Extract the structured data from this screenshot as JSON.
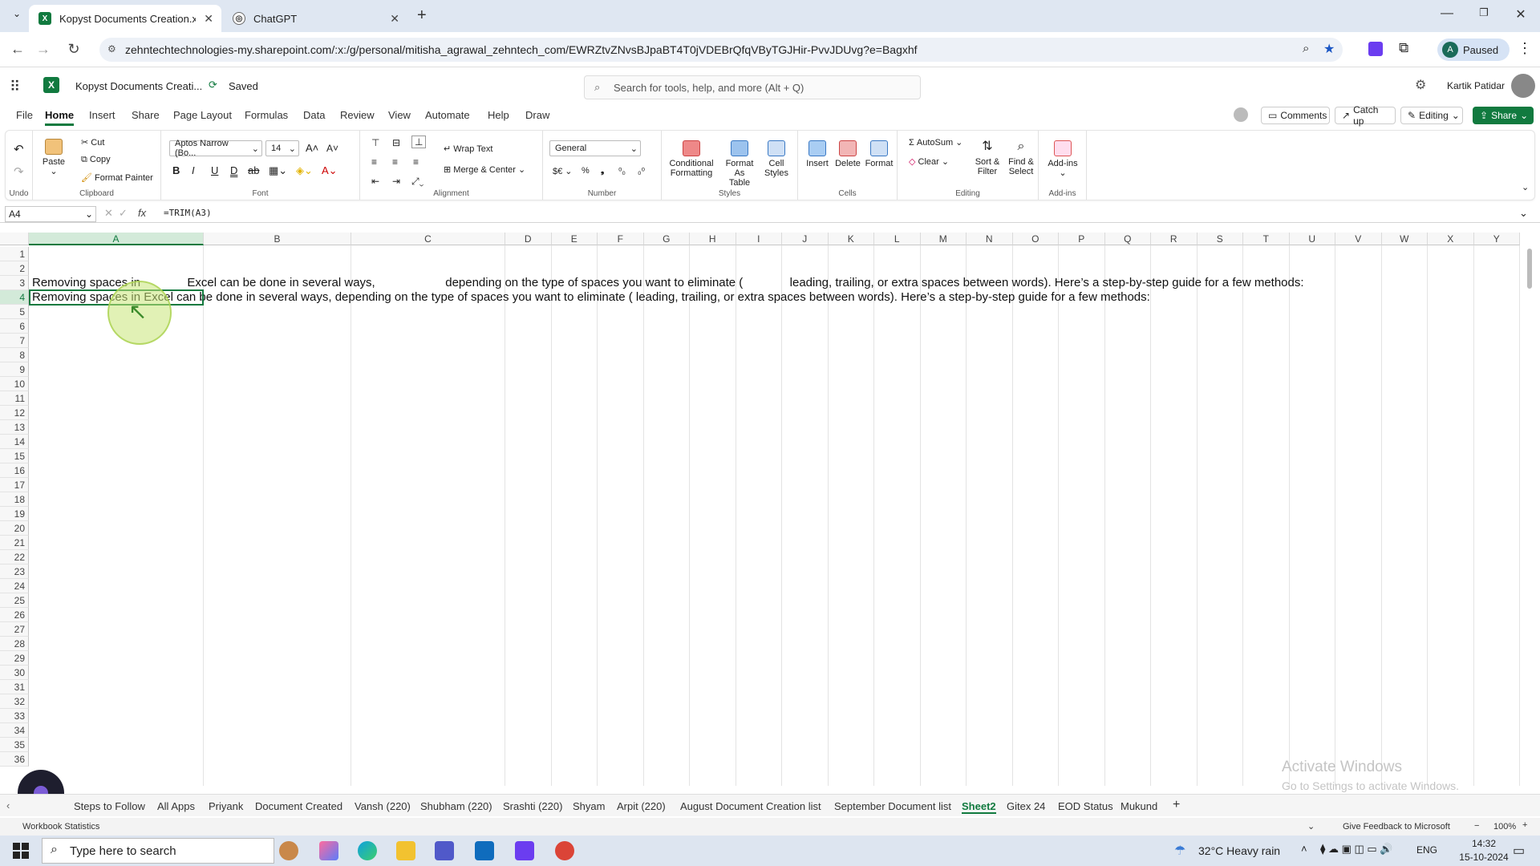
{
  "browser": {
    "tabs": [
      {
        "title": "Kopyst Documents Creation.xlsx"
      },
      {
        "title": "ChatGPT"
      }
    ],
    "new_tab": "+",
    "url": "zehntechtechnologies-my.sharepoint.com/:x:/g/personal/mitisha_agrawal_zehntech_com/EWRZtvZNvsBJpaBT4T0jVDEBrQfqVByTGJHir-PvvJDUvg?e=Bagxhf",
    "profile_letter": "A",
    "profile_status": "Paused"
  },
  "excel": {
    "doc_title": "Kopyst Documents Creati...",
    "save_status": "Saved",
    "search_placeholder": "Search for tools, help, and more (Alt + Q)",
    "user_name": "Kartik Patidar",
    "menu": [
      "File",
      "Home",
      "Insert",
      "Share",
      "Page Layout",
      "Formulas",
      "Data",
      "Review",
      "View",
      "Automate",
      "Help",
      "Draw"
    ],
    "active_menu": "Home",
    "comments": "Comments",
    "catch_up": "Catch up",
    "editing": "Editing",
    "share": "Share"
  },
  "ribbon": {
    "undo_label": "Undo",
    "paste": "Paste",
    "cut": "Cut",
    "copy": "Copy",
    "format_painter": "Format Painter",
    "clipboard_label": "Clipboard",
    "font_name": "Aptos Narrow (Bo...",
    "font_size": "14",
    "font_label": "Font",
    "wrap_text": "Wrap Text",
    "merge_center": "Merge & Center",
    "alignment_label": "Alignment",
    "number_format": "General",
    "number_label": "Number",
    "cond_fmt_1": "Conditional",
    "cond_fmt_2": "Formatting",
    "fmt_table_1": "Format As",
    "fmt_table_2": "Table",
    "cell_styles_1": "Cell",
    "cell_styles_2": "Styles",
    "styles_label": "Styles",
    "insert": "Insert",
    "delete": "Delete",
    "format": "Format",
    "cells_label": "Cells",
    "autosum": "AutoSum",
    "clear": "Clear",
    "sort_1": "Sort &",
    "sort_2": "Filter",
    "find_1": "Find &",
    "find_2": "Select",
    "editing_label": "Editing",
    "addins": "Add-ins",
    "addins_label": "Add-ins"
  },
  "formula_bar": {
    "name_box": "A4",
    "fx": "fx",
    "formula": "=TRIM(A3)"
  },
  "grid": {
    "columns": [
      "A",
      "B",
      "C",
      "D",
      "E",
      "F",
      "G",
      "H",
      "I",
      "J",
      "K",
      "L",
      "M",
      "N",
      "O",
      "P",
      "Q",
      "R",
      "S",
      "T",
      "U",
      "V",
      "W",
      "X",
      "Y"
    ],
    "selected_column": "A",
    "rows": [
      "1",
      "2",
      "3",
      "4",
      "5",
      "6",
      "7",
      "8",
      "9",
      "10",
      "11",
      "12",
      "13",
      "14",
      "15",
      "16",
      "17",
      "18",
      "19",
      "20",
      "21",
      "22",
      "23",
      "24",
      "25",
      "26",
      "27",
      "28",
      "29",
      "30",
      "31",
      "32",
      "33",
      "34",
      "35",
      "36"
    ],
    "selected_row": "4",
    "row3": "Removing spaces in              Excel can be done in several ways,                     depending on the type of spaces you want to eliminate (              leading, trailing, or extra spaces between words). Here’s a step-by-step guide for a few methods:",
    "row4": "Removing spaces in Excel can be done in several ways, depending on the type of spaces you want to eliminate ( leading, trailing, or extra spaces between words). Here’s a step-by-step guide for a few methods:"
  },
  "sheets": {
    "tabs": [
      "Steps to Follow",
      "All Apps",
      "Priyank",
      "Document Created",
      "Vansh (220)",
      "Shubham (220)",
      "Srashti (220)",
      "Shyam",
      "Arpit (220)",
      "August Document Creation list",
      "September Document list",
      "Sheet2",
      "Gitex 24",
      "EOD Status",
      "Mukund"
    ],
    "active": "Sheet2",
    "add": "+"
  },
  "status": {
    "left": "Workbook Statistics",
    "feedback": "Give Feedback to Microsoft",
    "zoom": "100%"
  },
  "watermark": {
    "line1": "Activate Windows",
    "line2": "Go to Settings to activate Windows."
  },
  "taskbar": {
    "search_placeholder": "Type here to search",
    "weather": "32°C  Heavy rain",
    "lang": "ENG",
    "time": "14:32",
    "date": "15-10-2024"
  },
  "colors": {
    "excel_green": "#117a3f",
    "tab_bg": "#dfe7f2",
    "taskbar_bg": "#dde5f0"
  }
}
